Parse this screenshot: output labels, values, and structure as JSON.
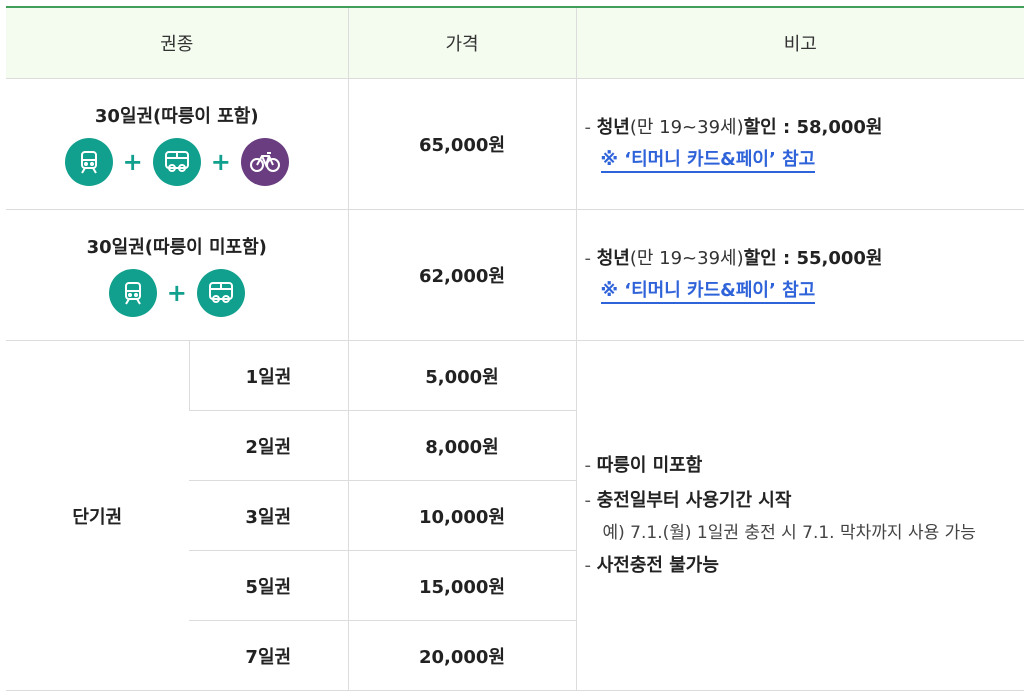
{
  "header": {
    "type": "권종",
    "price": "가격",
    "note": "비고"
  },
  "rows": {
    "monthly_with_bike": {
      "title": "30일권(따릉이 포함)",
      "price": "65,000원",
      "note_prefix": "- ",
      "youth_bold": "청년",
      "youth_age": "(만 19~39세)",
      "discount_bold": "할인 : 58,000원",
      "link": "※ ‘티머니 카드&페이’ 참고"
    },
    "monthly_without_bike": {
      "title": "30일권(따릉이 미포함)",
      "price": "62,000원",
      "note_prefix": "- ",
      "youth_bold": "청년",
      "youth_age": "(만 19~39세)",
      "discount_bold": "할인 : 55,000원",
      "link": "※ ‘티머니 카드&페이’ 참고"
    }
  },
  "short": {
    "label": "단기권",
    "items": [
      {
        "name": "1일권",
        "price": "5,000원"
      },
      {
        "name": "2일권",
        "price": "8,000원"
      },
      {
        "name": "3일권",
        "price": "10,000원"
      },
      {
        "name": "5일권",
        "price": "15,000원"
      },
      {
        "name": "7일권",
        "price": "20,000원"
      }
    ],
    "notes": {
      "n1": "따릉이 미포함",
      "n2": "충전일부터 사용기간 시작",
      "example": "예) 7.1.(월) 1일권 충전 시 7.1. 막차까지 사용 가능",
      "n3": "사전충전 불가능"
    }
  },
  "icons": {
    "subway": "subway-icon",
    "bus": "bus-icon",
    "bike": "bicycle-icon",
    "teal_color": "#11a08e",
    "purple_color": "#6a3d80"
  }
}
